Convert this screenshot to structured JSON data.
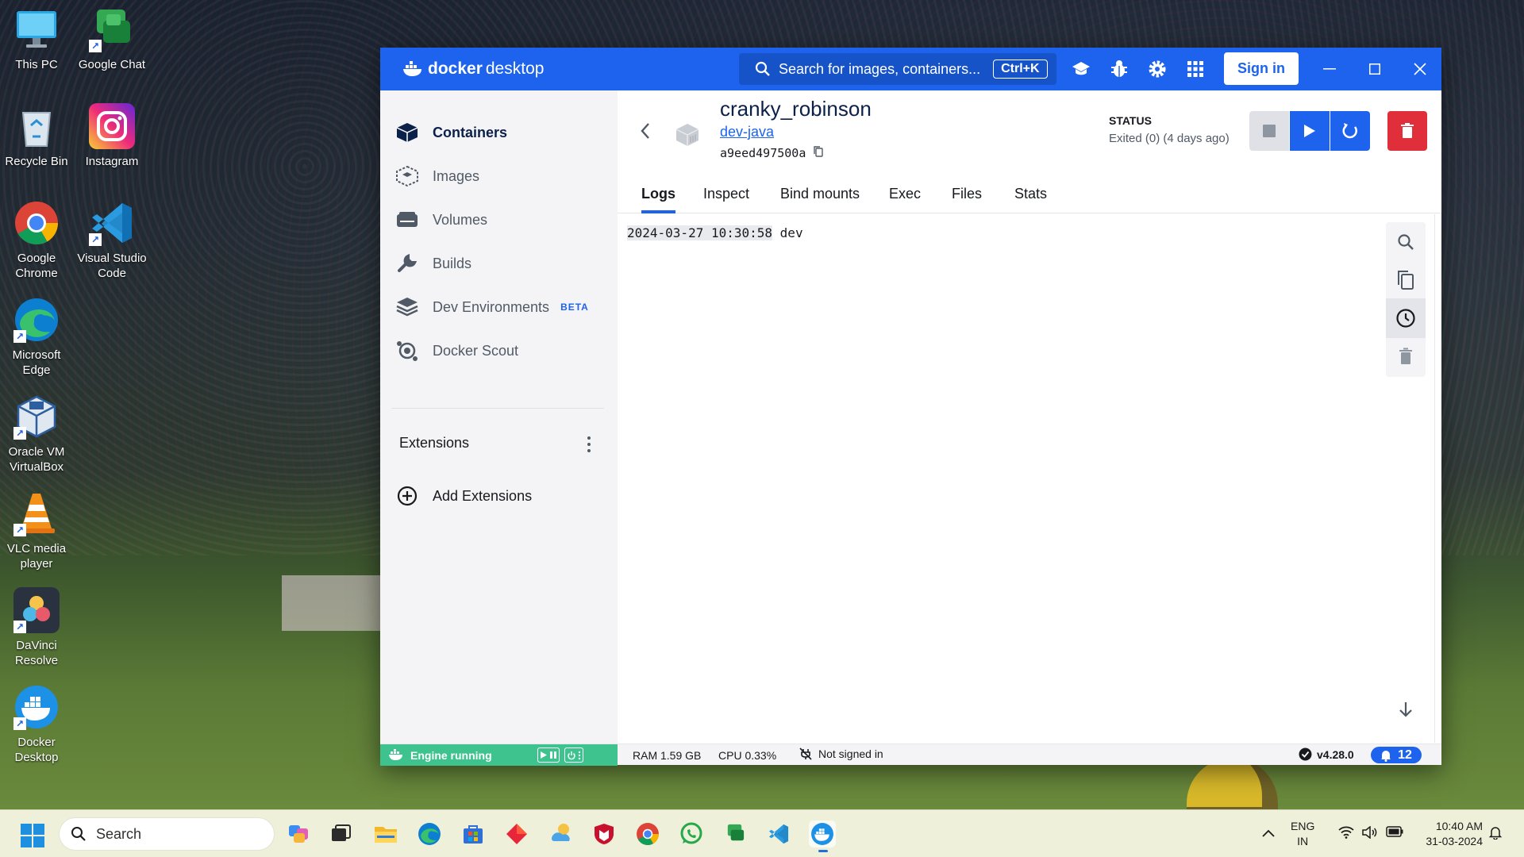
{
  "desktop": {
    "icons": [
      {
        "label": "This PC",
        "icon": "this-pc-icon"
      },
      {
        "label": "Google Chat",
        "icon": "google-chat-icon"
      },
      {
        "label": "Recycle Bin",
        "icon": "recycle-bin-icon"
      },
      {
        "label": "Instagram",
        "icon": "instagram-icon"
      },
      {
        "label": "Google Chrome",
        "icon": "chrome-icon"
      },
      {
        "label": "Visual Studio Code",
        "icon": "vscode-icon"
      },
      {
        "label": "Microsoft Edge",
        "icon": "edge-icon"
      },
      {
        "label": "Oracle VM VirtualBox",
        "icon": "virtualbox-icon"
      },
      {
        "label": "VLC media player",
        "icon": "vlc-icon"
      },
      {
        "label": "DaVinci Resolve",
        "icon": "davinci-icon"
      },
      {
        "label": "Docker Desktop",
        "icon": "docker-icon"
      }
    ]
  },
  "app": {
    "brand": "docker",
    "brand_suffix": "desktop",
    "search_placeholder": "Search for images, containers...",
    "search_shortcut": "Ctrl+K",
    "signin_label": "Sign in",
    "colors": {
      "primary": "#1d63ed",
      "danger": "#e02f3a",
      "engine": "#3ec28e"
    }
  },
  "sidebar": {
    "items": [
      {
        "label": "Containers",
        "icon": "containers-icon",
        "active": true
      },
      {
        "label": "Images",
        "icon": "images-icon"
      },
      {
        "label": "Volumes",
        "icon": "volumes-icon"
      },
      {
        "label": "Builds",
        "icon": "wrench-icon"
      },
      {
        "label": "Dev Environments",
        "icon": "dev-environments-icon",
        "badge": "BETA"
      },
      {
        "label": "Docker Scout",
        "icon": "docker-scout-icon"
      }
    ],
    "extensions_title": "Extensions",
    "add_extensions": "Add Extensions"
  },
  "container": {
    "name": "cranky_robinson",
    "image": "dev-java",
    "id": "a9eed497500a",
    "status_label": "STATUS",
    "status_value": "Exited (0) (4 days ago)"
  },
  "tabs": [
    "Logs",
    "Inspect",
    "Bind mounts",
    "Exec",
    "Files",
    "Stats"
  ],
  "active_tab": "Logs",
  "logs": [
    {
      "timestamp": "2024-03-27 10:30:58",
      "text": "dev"
    }
  ],
  "footer": {
    "engine_status": "Engine running",
    "ram": "RAM 1.59 GB",
    "cpu": "CPU 0.33%",
    "signin_status": "Not signed in",
    "version": "v4.28.0",
    "notifications": "12"
  },
  "taskbar": {
    "search_placeholder": "Search",
    "language_line1": "ENG",
    "language_line2": "IN",
    "time": "10:40 AM",
    "date": "31-03-2024"
  }
}
